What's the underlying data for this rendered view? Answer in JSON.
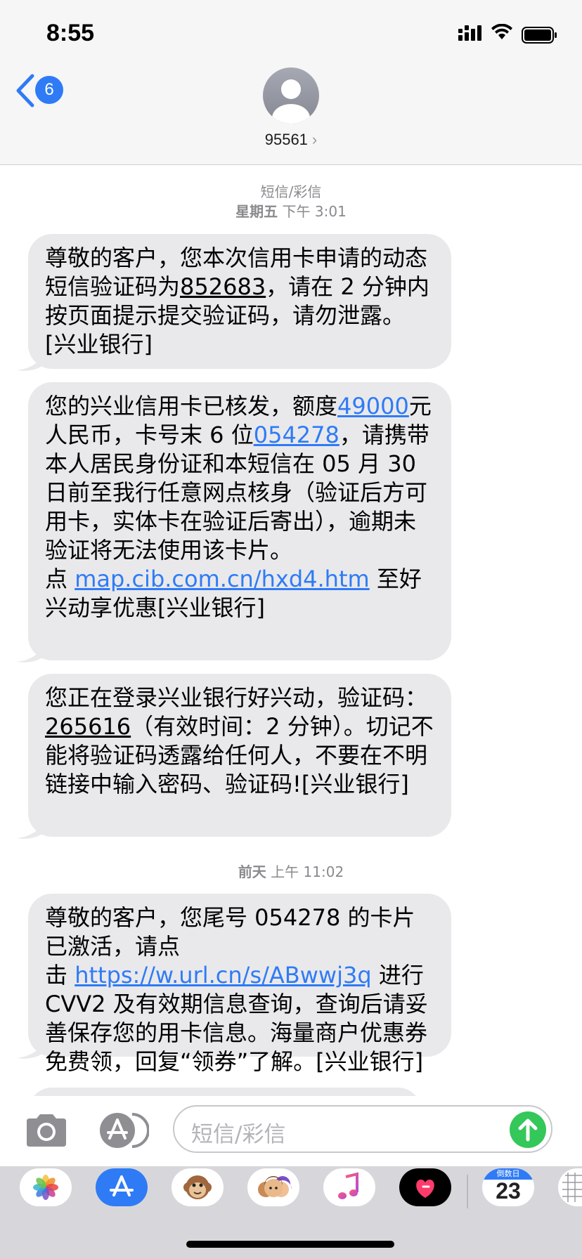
{
  "status_bar": {
    "time": "8:55"
  },
  "header": {
    "back_badge": "6",
    "contact_name": "95561",
    "chevron": "›"
  },
  "conversation": {
    "thread_label": "短信/彩信",
    "timestamp1": {
      "day": "星期五",
      "time": "下午 3:01"
    },
    "messages": [
      {
        "p1": "尊敬的客户，您本次信用卡申请的动态短信验证码为",
        "code": "852683",
        "p2": "，请在 2 分钟内按页面提示提交验证码，请勿泄露。[兴业银行]"
      },
      {
        "p1": "您的兴业信用卡已核发，额度",
        "amount": "49000",
        "p2": "元人民币，卡号末 6 位",
        "card": "054278",
        "p3": "，请携带本人居民身份证和本短信在 05 月 30 日前至我行任意网点核身（验证后方可用卡，实体卡在验证后寄出），逾期未验证将无法使用该卡片。点",
        "link": "map.cib.com.cn/hxd4.htm",
        "p4": "至好兴动享优惠[兴业银行]"
      },
      {
        "p1": "您正在登录兴业银行好兴动，验证码：",
        "code": "265616",
        "p2": "（有效时间：2 分钟）。切记不能将验证码透露给任何人，不要在不明链接中输入密码、验证码![兴业银行]"
      }
    ],
    "timestamp2": {
      "day": "前天",
      "time": "上午 11:02"
    },
    "messages2": [
      {
        "p1": "尊敬的客户，您尾号 054278 的卡片已激活，请点击",
        "link": "https://w.url.cn/s/ABwwj3q",
        "p2": "进行 CVV2 及有效期信息查询，查询后请妥善保存您的用卡信息。海量商户优惠券免费领，回复“领券”了解。[兴业银行]"
      }
    ]
  },
  "input_bar": {
    "placeholder": "短信/彩信"
  },
  "app_drawer": {
    "apps": [
      "photos-icon",
      "app-store-icon",
      "animoji-icon",
      "memoji-icon",
      "music-icon",
      "digital-touch-icon",
      "countdown-icon",
      "more-app-icon"
    ],
    "countdown_label": "倒数日",
    "countdown_value": "23"
  },
  "colors": {
    "link": "#2f7bf6",
    "bubble": "#e9e9eb",
    "send": "#34c759"
  }
}
